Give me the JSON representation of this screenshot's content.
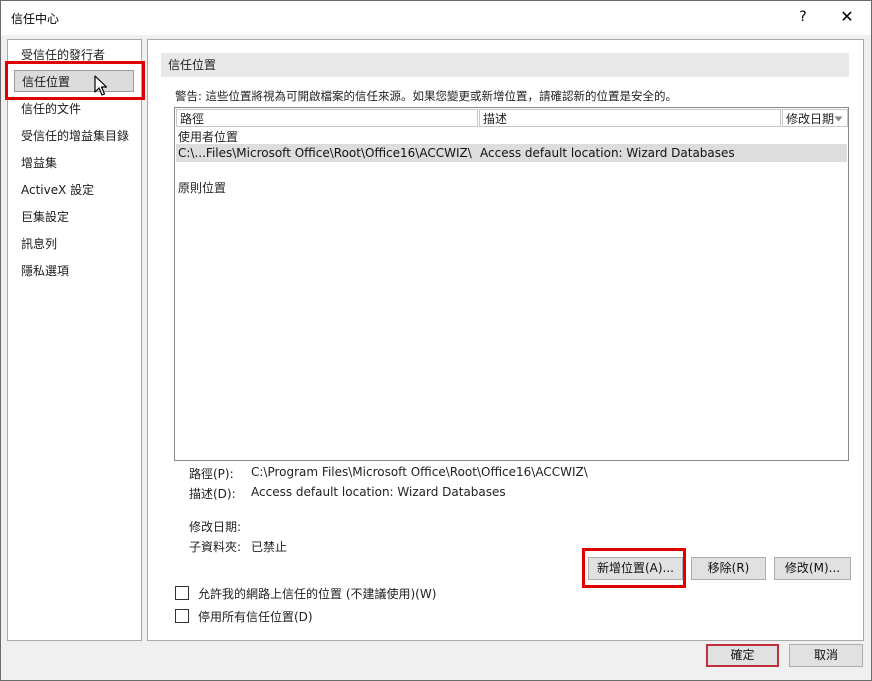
{
  "window": {
    "title": "信任中心",
    "help_glyph": "?",
    "close_glyph": "✕"
  },
  "sidebar": {
    "items": [
      {
        "label": "受信任的發行者"
      },
      {
        "label": "信任位置"
      },
      {
        "label": "信任的文件"
      },
      {
        "label": "受信任的增益集目錄"
      },
      {
        "label": "增益集"
      },
      {
        "label": "ActiveX 設定"
      },
      {
        "label": "巨集設定"
      },
      {
        "label": "訊息列"
      },
      {
        "label": "隱私選項"
      }
    ],
    "selected": "信任位置"
  },
  "main": {
    "section_title": "信任位置",
    "warning": "警告: 這些位置將視為可開啟檔案的信任來源。如果您變更或新增位置，請確認新的位置是安全的。",
    "list": {
      "columns": [
        "路徑",
        "描述",
        "修改日期"
      ],
      "sort_icon": "sort-down-icon",
      "groups": [
        {
          "label": "使用者位置",
          "rows": [
            {
              "path": "C:\\...Files\\Microsoft Office\\Root\\Office16\\ACCWIZ\\",
              "description": "Access default location: Wizard Databases",
              "modified": ""
            }
          ]
        },
        {
          "label": "原則位置",
          "rows": []
        }
      ]
    },
    "details": {
      "path_label": "路徑(P):",
      "path_value": "C:\\Program Files\\Microsoft Office\\Root\\Office16\\ACCWIZ\\",
      "desc_label": "描述(D):",
      "desc_value": "Access default location: Wizard Databases",
      "modified_label": "修改日期:",
      "modified_value": "",
      "subfolders_label": "子資料夾:",
      "subfolders_value": "已禁止"
    },
    "buttons": {
      "add": "新增位置(A)...",
      "remove": "移除(R)",
      "modify": "修改(M)..."
    },
    "checkboxes": [
      {
        "label": "允許我的網路上信任的位置 (不建議使用)(W)",
        "checked": false
      },
      {
        "label": "停用所有信任位置(D)",
        "checked": false
      }
    ]
  },
  "footer": {
    "ok": "確定",
    "cancel": "取消"
  },
  "colors": {
    "highlight_red": "#e00000",
    "selected_row": "#dddddd",
    "dialog_bg": "#f0f0f0"
  }
}
